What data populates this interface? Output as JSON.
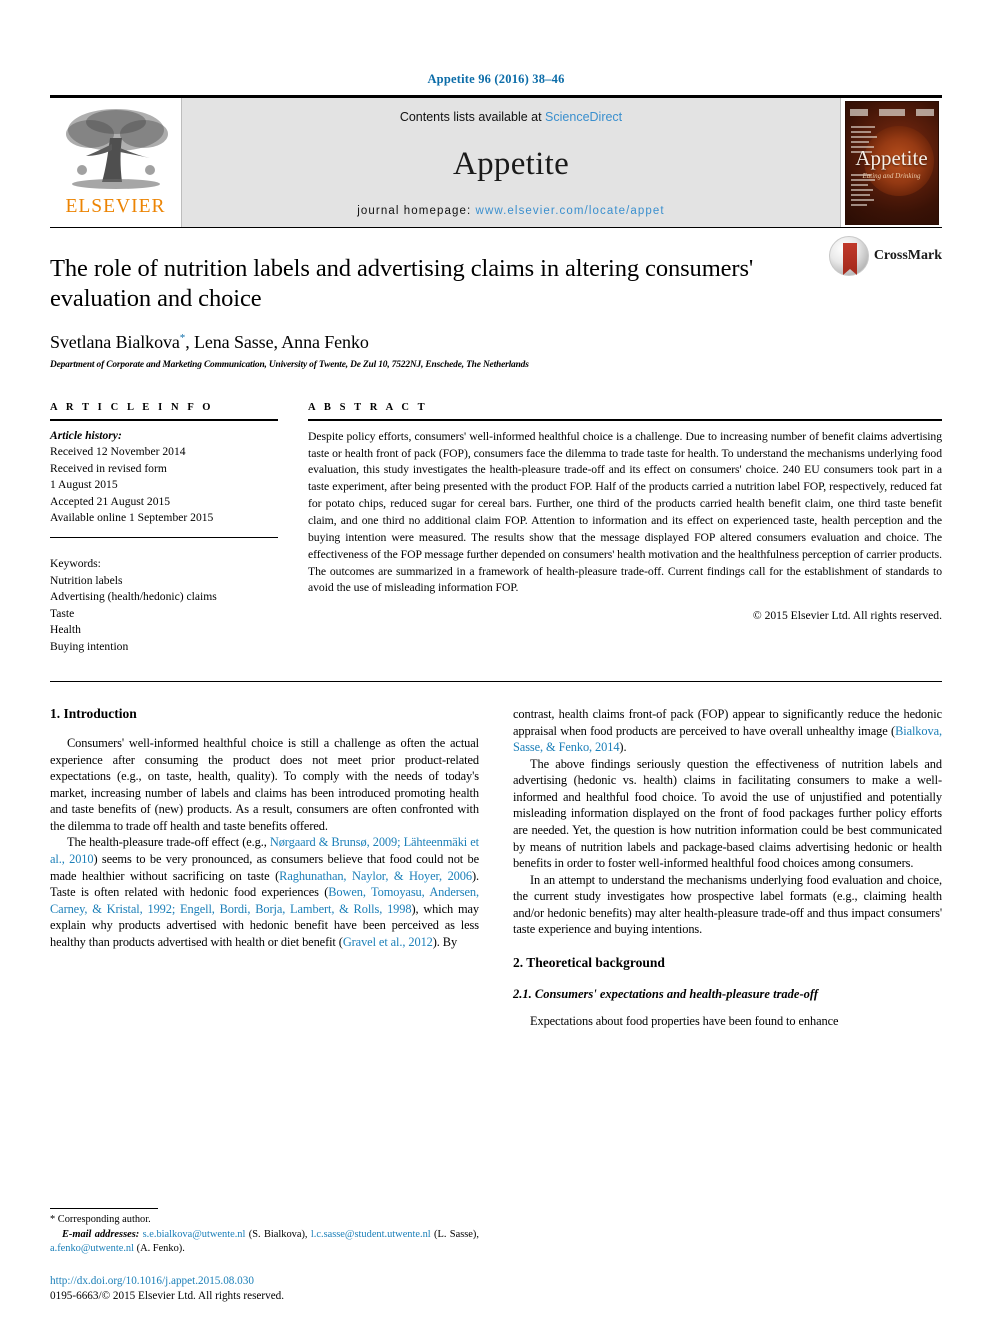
{
  "running_head": "Appetite 96 (2016) 38–46",
  "masthead": {
    "publisher_name": "ELSEVIER",
    "contents_prefix": "Contents lists available at ",
    "contents_link": "ScienceDirect",
    "journal_name": "Appetite",
    "homepage_prefix": "journal homepage: ",
    "homepage_url": "www.elsevier.com/locate/appet",
    "cover_title": "Appetite",
    "cover_subtitle": "Eating and Drinking"
  },
  "article": {
    "title": "The role of nutrition labels and advertising claims in altering consumers' evaluation and choice",
    "authors": "Svetlana Bialkova",
    "authors_rest": ", Lena Sasse, Anna Fenko",
    "corresponding_marker": "*",
    "affiliation": "Department of Corporate and Marketing Communication, University of Twente, De Zul 10, 7522NJ, Enschede, The Netherlands",
    "crossmark_label": "CrossMark"
  },
  "info": {
    "heading": "A R T I C L E   I N F O",
    "history_label": "Article history:",
    "history": [
      "Received 12 November 2014",
      "Received in revised form",
      "1 August 2015",
      "Accepted 21 August 2015",
      "Available online 1 September 2015"
    ],
    "keywords_label": "Keywords:",
    "keywords": [
      "Nutrition labels",
      "Advertising (health/hedonic) claims",
      "Taste",
      "Health",
      "Buying intention"
    ]
  },
  "abstract": {
    "heading": "A B S T R A C T",
    "text": "Despite policy efforts, consumers' well-informed healthful choice is a challenge. Due to increasing number of benefit claims advertising taste or health front of pack (FOP), consumers face the dilemma to trade taste for health. To understand the mechanisms underlying food evaluation, this study investigates the health-pleasure trade-off and its effect on consumers' choice. 240 EU consumers took part in a taste experiment, after being presented with the product FOP. Half of the products carried a nutrition label FOP, respectively, reduced fat for potato chips, reduced sugar for cereal bars. Further, one third of the products carried health benefit claim, one third taste benefit claim, and one third no additional claim FOP. Attention to information and its effect on experienced taste, health perception and the buying intention were measured. The results show that the message displayed FOP altered consumers evaluation and choice. The effectiveness of the FOP message further depended on consumers' health motivation and the healthfulness perception of carrier products. The outcomes are summarized in a framework of health-pleasure trade-off. Current findings call for the establishment of standards to avoid the use of misleading information FOP.",
    "copyright": "© 2015 Elsevier Ltd. All rights reserved."
  },
  "body": {
    "section1_heading": "1. Introduction",
    "p1_a": "Consumers' well-informed healthful choice is still a challenge as often the actual experience after consuming the product does not meet prior product-related expectations (e.g., on taste, health, quality). To comply with the needs of today's market, increasing number of labels and claims has been introduced promoting health and taste benefits of (new) products. As a result, consumers are often confronted with the dilemma to trade off health and taste benefits offered.",
    "p2_a": "The health-pleasure trade-off effect (e.g., ",
    "p2_cite1": "Nørgaard & Brunsø, 2009; Lähteenmäki et al., 2010",
    "p2_b": ") seems to be very pronounced, as consumers believe that food could not be made healthier without sacrificing on taste (",
    "p2_cite2": "Raghunathan, Naylor, & Hoyer, 2006",
    "p2_c": "). Taste is often related with hedonic food experiences (",
    "p2_cite3": "Bowen, Tomoyasu, Andersen, Carney, & Kristal, 1992; Engell, Bordi, Borja, Lambert, & Rolls, 1998",
    "p2_d": "), which may explain why products advertised with hedonic benefit have been perceived as less healthy than products advertised with health or diet benefit (",
    "p2_cite4": "Gravel et al., 2012",
    "p2_e": "). By",
    "p3_a": "contrast, health claims front-of pack (FOP) appear to significantly reduce the hedonic appraisal when food products are perceived to have overall unhealthy image (",
    "p3_cite1": "Bialkova, Sasse, & Fenko, 2014",
    "p3_b": ").",
    "p4": "The above findings seriously question the effectiveness of nutrition labels and advertising (hedonic vs. health) claims in facilitating consumers to make a well-informed and healthful food choice. To avoid the use of unjustified and potentially misleading information displayed on the front of food packages further policy efforts are needed. Yet, the question is how nutrition information could be best communicated by means of nutrition labels and package-based claims advertising hedonic or health benefits in order to foster well-informed healthful food choices among consumers.",
    "p5": "In an attempt to understand the mechanisms underlying food evaluation and choice, the current study investigates how prospective label formats (e.g., claiming health and/or hedonic benefits) may alter health-pleasure trade-off and thus impact consumers' taste experience and buying intentions.",
    "section2_heading": "2. Theoretical background",
    "section21_heading": "2.1. Consumers' expectations and health-pleasure trade-off",
    "p6": "Expectations about food properties have been found to enhance"
  },
  "footnote": {
    "corresponding": "* Corresponding author.",
    "email_label": "E-mail addresses:",
    "email1": "s.e.bialkova@utwente.nl",
    "email1_name": "(S. Bialkova)",
    "email2": "l.c.sasse@student.utwente.nl",
    "email2_name": "(L. Sasse)",
    "email3": "a.fenko@utwente.nl",
    "email3_name": "(A. Fenko)",
    "doi": "http://dx.doi.org/10.1016/j.appet.2015.08.030",
    "issn": "0195-6663/© 2015 Elsevier Ltd. All rights reserved."
  },
  "colors": {
    "link": "#1b7fb8",
    "elsevier_orange": "#ec8403",
    "header_blue": "#0b6ca8"
  }
}
